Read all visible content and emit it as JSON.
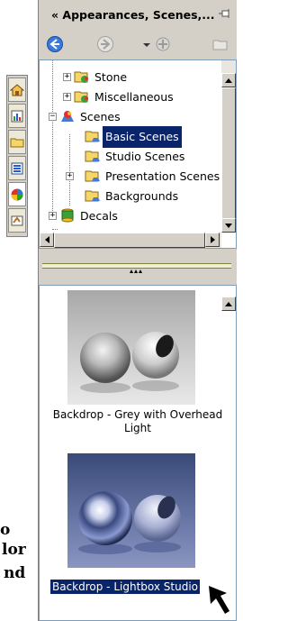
{
  "window": {
    "title": "« Appearances, Scenes,...",
    "pin_icon": "pushpin-icon"
  },
  "nav": {
    "back_icon": "back-arrow-icon",
    "forward_icon": "forward-arrow-icon",
    "add_location_icon": "add-file-location-icon",
    "open_folder_icon": "open-folder-icon"
  },
  "side_tabs": [
    {
      "name": "home-tab",
      "icon": "home-icon"
    },
    {
      "name": "chart-tab",
      "icon": "chart-icon"
    },
    {
      "name": "folder-tab",
      "icon": "folder-icon"
    },
    {
      "name": "list-tab",
      "icon": "list-icon"
    },
    {
      "name": "appearance-tab",
      "icon": "appearance-ball-icon",
      "active": true
    },
    {
      "name": "properties-tab",
      "icon": "properties-icon"
    }
  ],
  "tree": {
    "items": [
      {
        "label": "Stone",
        "icon": "appearance-folder-icon",
        "expander": "+",
        "level": 1
      },
      {
        "label": "Miscellaneous",
        "icon": "appearance-folder-icon",
        "expander": "+",
        "level": 1
      },
      {
        "label": "Scenes",
        "icon": "scenes-icon",
        "expander": "−",
        "level": 0
      },
      {
        "label": "Basic Scenes",
        "icon": "scene-folder-icon",
        "expander": "",
        "level": 1,
        "selected": true
      },
      {
        "label": "Studio Scenes",
        "icon": "scene-folder-icon",
        "expander": "",
        "level": 1
      },
      {
        "label": "Presentation Scenes",
        "icon": "scene-folder-icon",
        "expander": "+",
        "level": 1
      },
      {
        "label": "Backgrounds",
        "icon": "scene-folder-icon",
        "expander": "",
        "level": 1
      },
      {
        "label": "Decals",
        "icon": "decals-icon",
        "expander": "+",
        "level": 0
      }
    ]
  },
  "preview": {
    "items": [
      {
        "caption": "Backdrop - Grey with Overhead Light",
        "selected": false
      },
      {
        "caption": "Backdrop - Lightbox Studio",
        "selected": true
      }
    ]
  },
  "background_text": {
    "line1": "o",
    "line2": "lor",
    "line3": "nd"
  },
  "colors": {
    "selection": "#0a246a",
    "panel": "#d4d0c8"
  }
}
